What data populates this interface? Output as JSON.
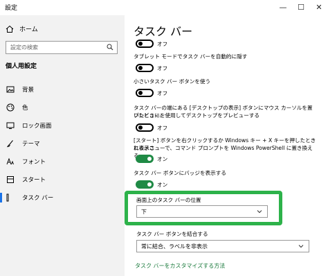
{
  "window": {
    "title": "設定",
    "minimize": "—",
    "maximize": "☐",
    "close": "✕"
  },
  "sidebar": {
    "home": "ホーム",
    "search_placeholder": "設定の検索",
    "section": "個人用設定",
    "items": [
      {
        "label": "背景",
        "icon": "picture-icon"
      },
      {
        "label": "色",
        "icon": "palette-icon"
      },
      {
        "label": "ロック画面",
        "icon": "lock-screen-icon"
      },
      {
        "label": "テーマ",
        "icon": "brush-icon"
      },
      {
        "label": "フォント",
        "icon": "font-icon"
      },
      {
        "label": "スタート",
        "icon": "start-icon"
      },
      {
        "label": "タスク バー",
        "icon": "taskbar-icon",
        "active": true
      }
    ],
    "accent": "#1a73e8"
  },
  "main": {
    "title": "タスク バー",
    "settings": [
      {
        "label": "",
        "state": "オフ",
        "on": false
      },
      {
        "label": "タブレット モードでタスク バーを自動的に隠す",
        "state": "オフ",
        "on": false
      },
      {
        "label": "小さいタスク バー ボタンを使う",
        "state": "オフ",
        "on": false
      },
      {
        "label_line1": "タスク バーの端にある [デスクトップの表示] ボタンにマウス カーソルを置いたときに、",
        "label_line2": "プレビューを使用してデスクトップをプレビューする",
        "state": "オフ",
        "on": false
      },
      {
        "label_line1": "[スタート] ボタンを右クリックするか Windows キー + X キーを押したときに表示さ",
        "label_line2": "れるメニューで、コマンド プロンプトを Windows PowerShell に置き換える",
        "state": "オン",
        "on": true
      },
      {
        "label": "タスク バー ボタンにバッジを表示する",
        "state": "オン",
        "on": true
      }
    ],
    "position": {
      "label": "画面上のタスク バーの位置",
      "value": "下"
    },
    "combine": {
      "label": "タスク バー ボタンを結合する",
      "value": "常に結合、ラベルを非表示"
    },
    "customize_link": "タスク バーをカスタマイズする方法",
    "toggle_on_color": "#1f8a45",
    "highlight_color": "#2db24a"
  }
}
